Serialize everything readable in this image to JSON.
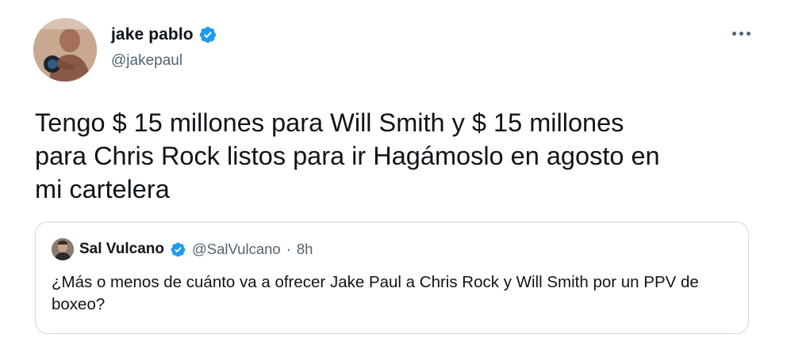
{
  "tweet": {
    "display_name": "jake pablo",
    "handle": "@jakepaul",
    "text": "Tengo $ 15 millones para Will Smith y $ 15 millones\npara Chris Rock listos para ir Hagámoslo en agosto en\nmi cartelera",
    "more_icon": "more-horizontal-icon",
    "verified_icon": "verified-badge-icon"
  },
  "quoted_tweet": {
    "display_name": "Sal Vulcano",
    "handle": "@SalVulcano",
    "separator": "·",
    "time": "8h",
    "text": "¿Más o menos de cuánto va a ofrecer Jake Paul a Chris Rock y Will Smith por un PPV de boxeo?"
  },
  "colors": {
    "verified_blue": "#1d9bf0",
    "text_primary": "#0f1419",
    "text_secondary": "#536471",
    "border": "#cfd9de"
  }
}
